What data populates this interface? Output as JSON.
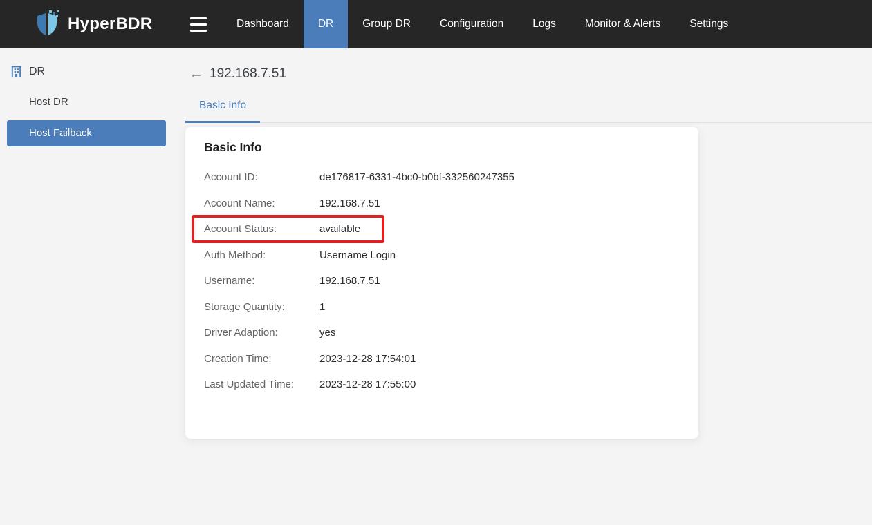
{
  "colors": {
    "accent_blue": "#4a7dba",
    "navbar_bg": "#262626",
    "highlight_red": "#e02121",
    "page_bg": "#f4f4f5"
  },
  "navbar": {
    "brand": "HyperBDR",
    "items": [
      {
        "label": "Dashboard",
        "active": false
      },
      {
        "label": "DR",
        "active": true
      },
      {
        "label": "Group DR",
        "active": false
      },
      {
        "label": "Configuration",
        "active": false
      },
      {
        "label": "Logs",
        "active": false
      },
      {
        "label": "Monitor & Alerts",
        "active": false
      },
      {
        "label": "Settings",
        "active": false
      }
    ]
  },
  "sidebar": {
    "section_label": "DR",
    "items": [
      {
        "label": "Host DR",
        "active": false
      },
      {
        "label": "Host Failback",
        "active": true
      }
    ]
  },
  "page": {
    "back_icon": "←",
    "title": "192.168.7.51",
    "tabs": [
      {
        "label": "Basic Info",
        "active": true
      }
    ]
  },
  "card": {
    "title": "Basic Info",
    "rows": [
      {
        "label": "Account ID:",
        "value": "de176817-6331-4bc0-b0bf-332560247355",
        "highlighted": false
      },
      {
        "label": "Account Name:",
        "value": "192.168.7.51",
        "highlighted": false
      },
      {
        "label": "Account Status:",
        "value": "available",
        "highlighted": true
      },
      {
        "label": "Auth Method:",
        "value": "Username Login",
        "highlighted": false
      },
      {
        "label": "Username:",
        "value": "192.168.7.51",
        "highlighted": false
      },
      {
        "label": "Storage Quantity:",
        "value": "1",
        "highlighted": false
      },
      {
        "label": "Driver Adaption:",
        "value": "yes",
        "highlighted": false
      },
      {
        "label": "Creation Time:",
        "value": "2023-12-28 17:54:01",
        "highlighted": false
      },
      {
        "label": "Last Updated Time:",
        "value": "2023-12-28 17:55:00",
        "highlighted": false
      }
    ]
  }
}
